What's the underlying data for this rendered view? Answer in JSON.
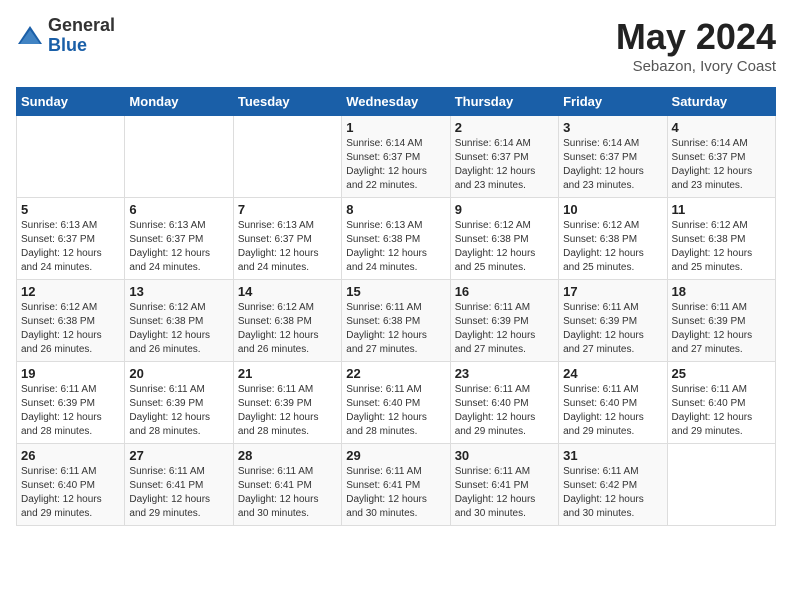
{
  "logo": {
    "general": "General",
    "blue": "Blue"
  },
  "title": {
    "month": "May 2024",
    "location": "Sebazon, Ivory Coast"
  },
  "weekdays": [
    "Sunday",
    "Monday",
    "Tuesday",
    "Wednesday",
    "Thursday",
    "Friday",
    "Saturday"
  ],
  "weeks": [
    [
      {
        "day": "",
        "info": ""
      },
      {
        "day": "",
        "info": ""
      },
      {
        "day": "",
        "info": ""
      },
      {
        "day": "1",
        "info": "Sunrise: 6:14 AM\nSunset: 6:37 PM\nDaylight: 12 hours\nand 22 minutes."
      },
      {
        "day": "2",
        "info": "Sunrise: 6:14 AM\nSunset: 6:37 PM\nDaylight: 12 hours\nand 23 minutes."
      },
      {
        "day": "3",
        "info": "Sunrise: 6:14 AM\nSunset: 6:37 PM\nDaylight: 12 hours\nand 23 minutes."
      },
      {
        "day": "4",
        "info": "Sunrise: 6:14 AM\nSunset: 6:37 PM\nDaylight: 12 hours\nand 23 minutes."
      }
    ],
    [
      {
        "day": "5",
        "info": "Sunrise: 6:13 AM\nSunset: 6:37 PM\nDaylight: 12 hours\nand 24 minutes."
      },
      {
        "day": "6",
        "info": "Sunrise: 6:13 AM\nSunset: 6:37 PM\nDaylight: 12 hours\nand 24 minutes."
      },
      {
        "day": "7",
        "info": "Sunrise: 6:13 AM\nSunset: 6:37 PM\nDaylight: 12 hours\nand 24 minutes."
      },
      {
        "day": "8",
        "info": "Sunrise: 6:13 AM\nSunset: 6:38 PM\nDaylight: 12 hours\nand 24 minutes."
      },
      {
        "day": "9",
        "info": "Sunrise: 6:12 AM\nSunset: 6:38 PM\nDaylight: 12 hours\nand 25 minutes."
      },
      {
        "day": "10",
        "info": "Sunrise: 6:12 AM\nSunset: 6:38 PM\nDaylight: 12 hours\nand 25 minutes."
      },
      {
        "day": "11",
        "info": "Sunrise: 6:12 AM\nSunset: 6:38 PM\nDaylight: 12 hours\nand 25 minutes."
      }
    ],
    [
      {
        "day": "12",
        "info": "Sunrise: 6:12 AM\nSunset: 6:38 PM\nDaylight: 12 hours\nand 26 minutes."
      },
      {
        "day": "13",
        "info": "Sunrise: 6:12 AM\nSunset: 6:38 PM\nDaylight: 12 hours\nand 26 minutes."
      },
      {
        "day": "14",
        "info": "Sunrise: 6:12 AM\nSunset: 6:38 PM\nDaylight: 12 hours\nand 26 minutes."
      },
      {
        "day": "15",
        "info": "Sunrise: 6:11 AM\nSunset: 6:38 PM\nDaylight: 12 hours\nand 27 minutes."
      },
      {
        "day": "16",
        "info": "Sunrise: 6:11 AM\nSunset: 6:39 PM\nDaylight: 12 hours\nand 27 minutes."
      },
      {
        "day": "17",
        "info": "Sunrise: 6:11 AM\nSunset: 6:39 PM\nDaylight: 12 hours\nand 27 minutes."
      },
      {
        "day": "18",
        "info": "Sunrise: 6:11 AM\nSunset: 6:39 PM\nDaylight: 12 hours\nand 27 minutes."
      }
    ],
    [
      {
        "day": "19",
        "info": "Sunrise: 6:11 AM\nSunset: 6:39 PM\nDaylight: 12 hours\nand 28 minutes."
      },
      {
        "day": "20",
        "info": "Sunrise: 6:11 AM\nSunset: 6:39 PM\nDaylight: 12 hours\nand 28 minutes."
      },
      {
        "day": "21",
        "info": "Sunrise: 6:11 AM\nSunset: 6:39 PM\nDaylight: 12 hours\nand 28 minutes."
      },
      {
        "day": "22",
        "info": "Sunrise: 6:11 AM\nSunset: 6:40 PM\nDaylight: 12 hours\nand 28 minutes."
      },
      {
        "day": "23",
        "info": "Sunrise: 6:11 AM\nSunset: 6:40 PM\nDaylight: 12 hours\nand 29 minutes."
      },
      {
        "day": "24",
        "info": "Sunrise: 6:11 AM\nSunset: 6:40 PM\nDaylight: 12 hours\nand 29 minutes."
      },
      {
        "day": "25",
        "info": "Sunrise: 6:11 AM\nSunset: 6:40 PM\nDaylight: 12 hours\nand 29 minutes."
      }
    ],
    [
      {
        "day": "26",
        "info": "Sunrise: 6:11 AM\nSunset: 6:40 PM\nDaylight: 12 hours\nand 29 minutes."
      },
      {
        "day": "27",
        "info": "Sunrise: 6:11 AM\nSunset: 6:41 PM\nDaylight: 12 hours\nand 29 minutes."
      },
      {
        "day": "28",
        "info": "Sunrise: 6:11 AM\nSunset: 6:41 PM\nDaylight: 12 hours\nand 30 minutes."
      },
      {
        "day": "29",
        "info": "Sunrise: 6:11 AM\nSunset: 6:41 PM\nDaylight: 12 hours\nand 30 minutes."
      },
      {
        "day": "30",
        "info": "Sunrise: 6:11 AM\nSunset: 6:41 PM\nDaylight: 12 hours\nand 30 minutes."
      },
      {
        "day": "31",
        "info": "Sunrise: 6:11 AM\nSunset: 6:42 PM\nDaylight: 12 hours\nand 30 minutes."
      },
      {
        "day": "",
        "info": ""
      }
    ]
  ]
}
